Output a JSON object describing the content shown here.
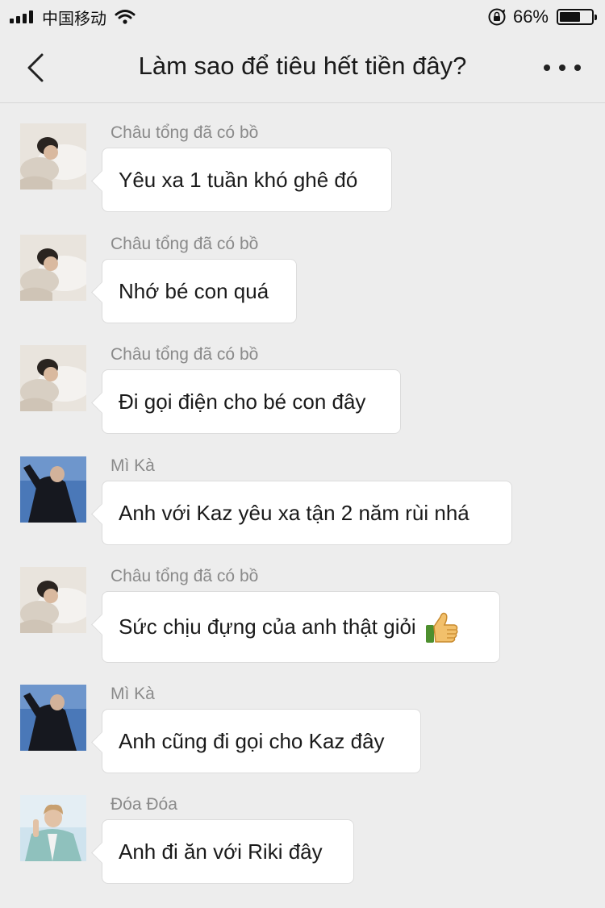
{
  "status_bar": {
    "carrier": "中国移动",
    "battery_percent_text": "66%",
    "battery_level": 0.66
  },
  "nav": {
    "title": "Làm sao để tiêu hết tiền đây?",
    "back_icon": "chevron-left-icon",
    "more_icon": "more-dots-icon"
  },
  "messages": [
    {
      "sender": "Châu tổng đã có bồ",
      "text": "Yêu xa 1 tuần khó ghê đó",
      "avatar": "avatar-chau"
    },
    {
      "sender": "Châu tổng đã có bồ",
      "text": "Nhớ bé con quá",
      "avatar": "avatar-chau"
    },
    {
      "sender": "Châu tổng đã có bồ",
      "text": "Đi gọi điện cho bé con đây",
      "avatar": "avatar-chau"
    },
    {
      "sender": "Mì Kà",
      "text": "Anh với Kaz yêu xa tận 2 năm rùi nhá",
      "avatar": "avatar-mika"
    },
    {
      "sender": "Châu tổng đã có bồ",
      "text": "Sức chịu đựng của anh thật giỏi",
      "emoji": "thumbs-up-icon",
      "avatar": "avatar-chau"
    },
    {
      "sender": "Mì Kà",
      "text": "Anh cũng đi gọi cho Kaz đây",
      "avatar": "avatar-mika"
    },
    {
      "sender": "Đóa Đóa",
      "text": "Anh đi ăn với Riki đây",
      "avatar": "avatar-doa"
    }
  ]
}
